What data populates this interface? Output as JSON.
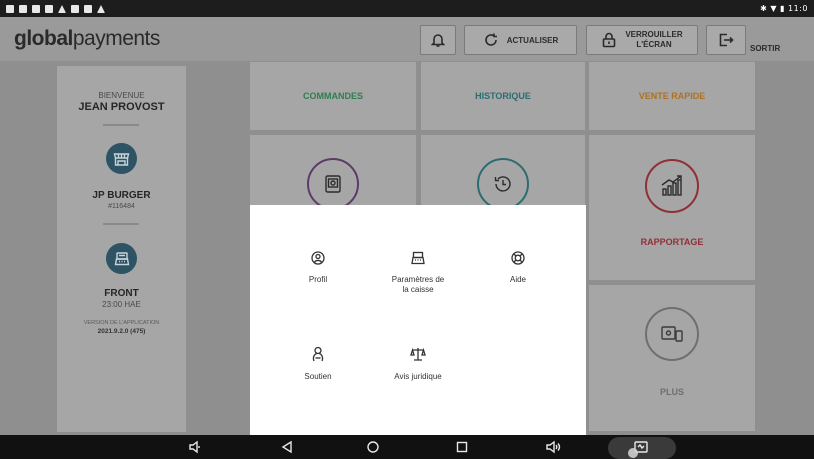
{
  "status_bar": {
    "time": "11:0"
  },
  "header": {
    "logo_bold": "global",
    "logo_light": "payments",
    "refresh_label": "ACTUALISER",
    "lock_label_line1": "VERROUILLER",
    "lock_label_line2": "L'ÉCRAN",
    "logout_label": "SORTIR"
  },
  "sidebar": {
    "welcome": "BIENVENUE",
    "user_name": "JEAN PROVOST",
    "store_name": "JP BURGER",
    "store_id": "#116484",
    "terminal_name": "FRONT",
    "terminal_time": "23:00 HAE",
    "version_label": "VERSION DE L'APPLICATION",
    "version_value": "2021.9.2.0 (475)"
  },
  "tiles": {
    "orders": "COMMANDES",
    "history": "HISTORIQUE",
    "quick_sale": "VENTE RAPIDE",
    "reporting": "RAPPORTAGE",
    "more": "PLUS"
  },
  "menu": {
    "profile": "Profil",
    "register_settings_line1": "Paramètres de",
    "register_settings_line2": "la caisse",
    "help": "Aide",
    "support": "Soutien",
    "legal": "Avis juridique"
  },
  "colors": {
    "orders_green": "#2f7d52",
    "history_teal": "#2c6c70",
    "quick_sale_orange": "#b0701f",
    "reporting_red": "#8f2f36",
    "purple_ring": "#5b3b6a",
    "sidebar_circle": "#2d5364"
  }
}
